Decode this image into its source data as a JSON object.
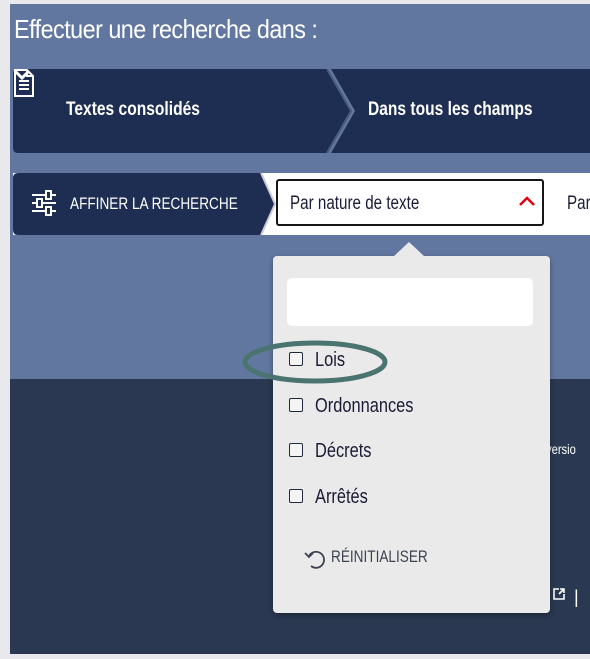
{
  "heading": "Effectuer une recherche dans :",
  "search_bar": {
    "text_type": "Textes consolidés",
    "field_scope": "Dans tous les champs"
  },
  "refine": {
    "label": "AFFINER LA RECHERCHE",
    "nature_filter": "Par nature de texte",
    "next_filter": "Par"
  },
  "dropdown": {
    "search_value": "",
    "options": [
      {
        "label": "Lois",
        "checked": false
      },
      {
        "label": "Ordonnances",
        "checked": false
      },
      {
        "label": "Décrets",
        "checked": false
      },
      {
        "label": "Arrêtés",
        "checked": false
      }
    ],
    "reset_label": "RÉINITIALISER"
  },
  "background": {
    "partial_text": "versio",
    "separator": "|"
  },
  "icons": {
    "document": "document-icon",
    "chevron": "chevron-down-icon",
    "sliders": "sliders-icon",
    "caret": "caret-up-icon",
    "reset": "undo-icon",
    "external": "external-link-icon"
  },
  "colors": {
    "top_band": "#6277a0",
    "navy": "#1e2e52",
    "dark_background": "#2a3851",
    "panel": "#eaeaea",
    "accent_red": "#e1000f",
    "highlight": "#4a7470"
  }
}
